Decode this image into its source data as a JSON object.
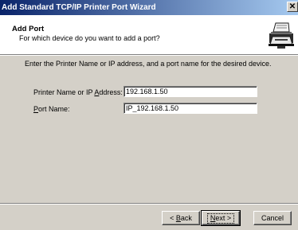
{
  "window": {
    "title": "Add Standard TCP/IP Printer Port Wizard",
    "close_glyph": "✕"
  },
  "header": {
    "title": "Add Port",
    "subtitle": "For which device do you want to add a port?",
    "icon": "printer-network-icon"
  },
  "body": {
    "instruction": "Enter the Printer Name or IP address, and a port name for the desired device.",
    "fields": {
      "address": {
        "label_pre": "Printer Name or IP ",
        "label_hotkey": "A",
        "label_post": "ddress:",
        "value": "192.168.1.50"
      },
      "port": {
        "label_pre": "",
        "label_hotkey": "P",
        "label_post": "ort Name:",
        "value": "IP_192.168.1.50"
      }
    }
  },
  "buttons": {
    "back": {
      "pre": "< ",
      "hotkey": "B",
      "post": "ack"
    },
    "next": {
      "pre": "",
      "hotkey": "N",
      "post": "ext >"
    },
    "cancel": {
      "label": "Cancel"
    }
  },
  "colors": {
    "title_gradient_start": "#0a246a",
    "title_gradient_end": "#a6caf0",
    "dialog_face": "#d4d0c8"
  }
}
